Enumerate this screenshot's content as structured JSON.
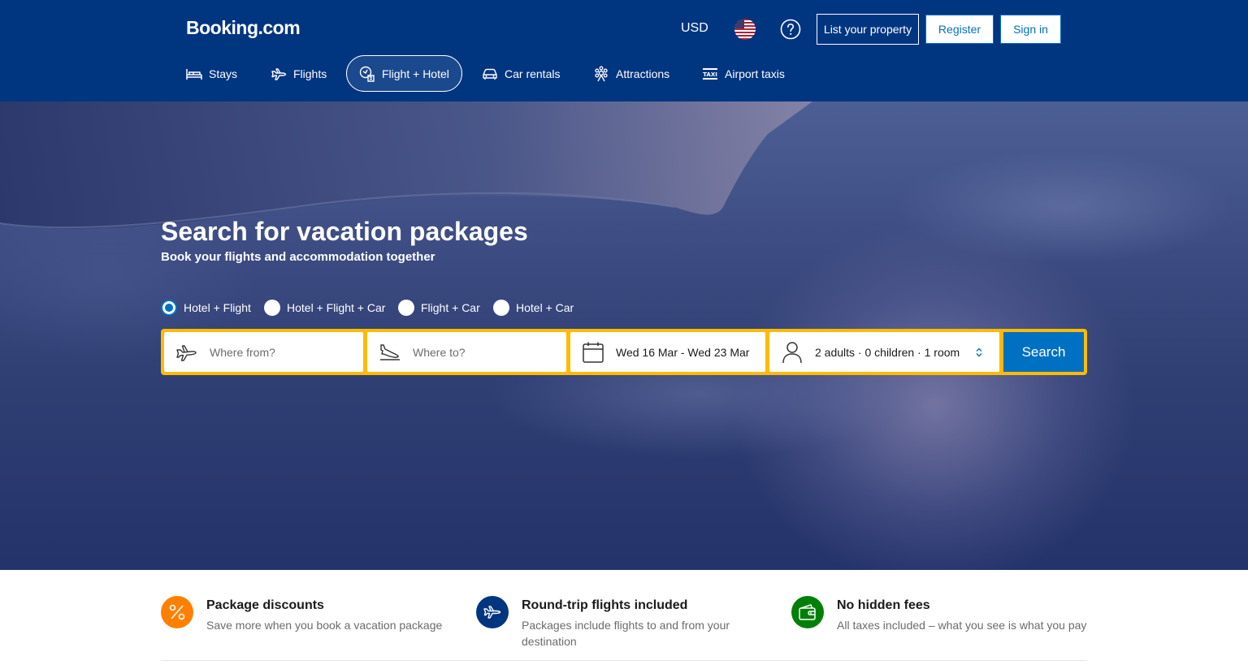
{
  "header": {
    "logo": "Booking.com",
    "currency": "USD",
    "list_property": "List your property",
    "register": "Register",
    "sign_in": "Sign in"
  },
  "nav": {
    "items": [
      {
        "label": "Stays",
        "icon": "bed-icon",
        "active": false
      },
      {
        "label": "Flights",
        "icon": "plane-icon",
        "active": false
      },
      {
        "label": "Flight + Hotel",
        "icon": "flight-hotel-icon",
        "active": true
      },
      {
        "label": "Car rentals",
        "icon": "car-icon",
        "active": false
      },
      {
        "label": "Attractions",
        "icon": "attractions-icon",
        "active": false
      },
      {
        "label": "Airport taxis",
        "icon": "taxi-icon",
        "active": false
      }
    ]
  },
  "hero": {
    "title": "Search for vacation packages",
    "subtitle": "Book your flights and accommodation together",
    "options": [
      "Hotel + Flight",
      "Hotel + Flight + Car",
      "Flight + Car",
      "Hotel + Car"
    ],
    "selected_option": "Hotel + Flight"
  },
  "search": {
    "from_placeholder": "Where from?",
    "to_placeholder": "Where to?",
    "dates": "Wed 16 Mar - Wed 23 Mar",
    "guests": "2 adults · 0 children · 1 room",
    "button": "Search"
  },
  "benefits": [
    {
      "title": "Package discounts",
      "desc": "Save more when you book a vacation package",
      "icon": "percent-icon",
      "color": "#ff8000"
    },
    {
      "title": "Round-trip flights included",
      "desc": "Packages include flights to and from your destination",
      "icon": "plane-icon",
      "color": "#003580"
    },
    {
      "title": "No hidden fees",
      "desc": "All taxes included – what you see is what you pay",
      "icon": "wallet-icon",
      "color": "#008009"
    }
  ],
  "colors": {
    "brand": "#003580",
    "accent": "#0071c2",
    "highlight": "#febb02"
  }
}
